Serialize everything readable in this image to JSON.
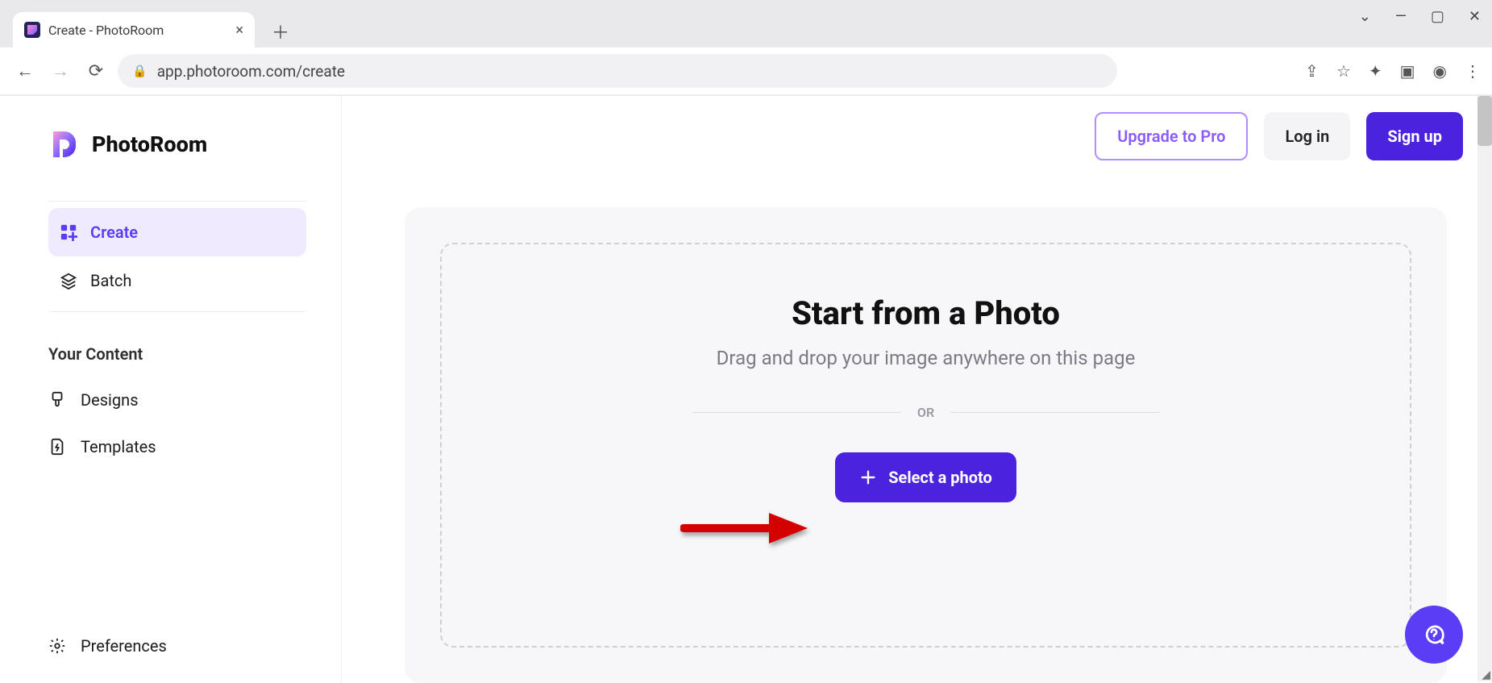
{
  "window": {
    "tab_title": "Create - PhotoRoom",
    "url": "app.photoroom.com/create"
  },
  "brand": {
    "name": "PhotoRoom"
  },
  "sidebar": {
    "nav": [
      {
        "label": "Create",
        "icon": "grid-plus-icon",
        "active": true
      },
      {
        "label": "Batch",
        "icon": "layers-icon",
        "active": false
      }
    ],
    "section_label": "Your Content",
    "content": [
      {
        "label": "Designs",
        "icon": "brush-icon"
      },
      {
        "label": "Templates",
        "icon": "file-bolt-icon"
      }
    ],
    "preferences_label": "Preferences"
  },
  "topbar": {
    "upgrade_label": "Upgrade to Pro",
    "login_label": "Log in",
    "signup_label": "Sign up"
  },
  "dropzone": {
    "title": "Start from a Photo",
    "subtitle": "Drag and drop your image anywhere on this page",
    "or_label": "OR",
    "select_label": "Select a photo"
  },
  "colors": {
    "primary": "#4b22dd",
    "primary_light": "#efeafe",
    "accent_border": "#b18dff",
    "text": "#111111",
    "muted": "#7b7b86"
  }
}
